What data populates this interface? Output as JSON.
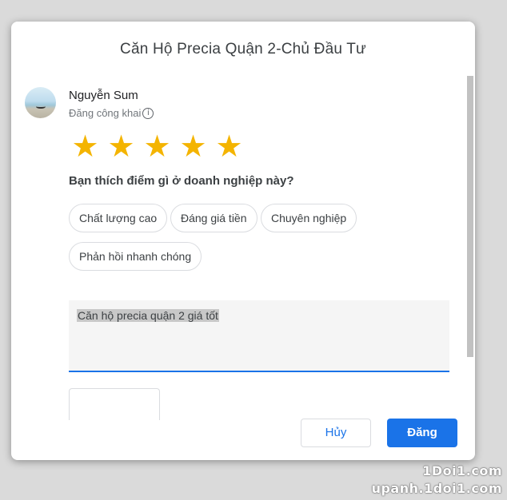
{
  "dialog": {
    "title": "Căn Hộ Precia Quận 2-Chủ Đầu Tư"
  },
  "user": {
    "name": "Nguyễn Sum",
    "visibility_label": "Đăng công khai",
    "info_icon_glyph": "i"
  },
  "rating": {
    "value": 5,
    "max": 5,
    "star_glyph": "★",
    "star_color": "#f4b400"
  },
  "question": "Bạn thích điểm gì ở doanh nghiệp này?",
  "chips": [
    "Chất lượng cao",
    "Đáng giá tiền",
    "Chuyên nghiệp",
    "Phản hồi nhanh chóng"
  ],
  "review_input": {
    "value": "Căn hộ precia quận 2 giá tốt"
  },
  "buttons": {
    "cancel_label": "Hủy",
    "post_label": "Đăng"
  },
  "colors": {
    "accent": "#1a73e8"
  },
  "watermark": {
    "line1": "1Doi1.com",
    "line2": "upanh.1doi1.com"
  }
}
